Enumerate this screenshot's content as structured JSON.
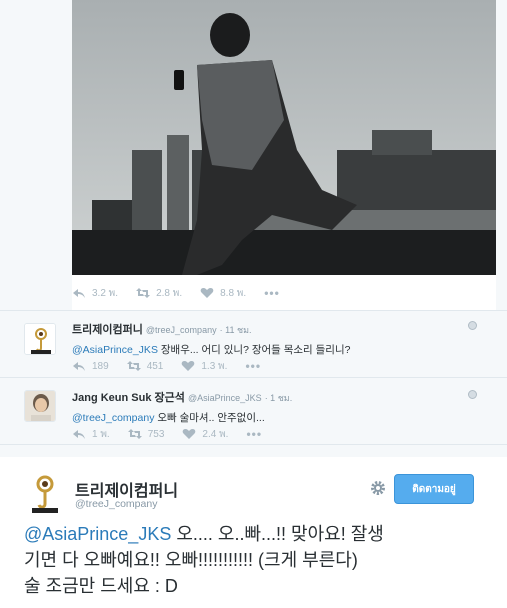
{
  "photo_tweet": {
    "stats": {
      "replies": "3.2 พ.",
      "retweets": "2.8 พ.",
      "likes": "8.8 พ."
    },
    "more_label": "•••"
  },
  "reply1": {
    "name": "트리제이컴퍼니",
    "handle": "@treeJ_company",
    "time": "· 11 ชม.",
    "mention": "@AsiaPrince_JKS",
    "text": " 장배우... 어디 있니? 장어들 목소리 들리니?",
    "stats": {
      "replies": "189",
      "retweets": "451",
      "likes": "1.3 พ."
    },
    "more_label": "•••"
  },
  "reply2": {
    "name": "Jang Keun Suk 장근석",
    "handle": "@AsiaPrince_JKS",
    "time": "· 1 ชม.",
    "mention": "@treeJ_company",
    "text": " 오빠 술마셔.. 안주없이...",
    "stats": {
      "replies": "1 พ.",
      "retweets": "753",
      "likes": "2.4 พ."
    },
    "more_label": "•••"
  },
  "main_tweet": {
    "name": "트리제이컴퍼니",
    "handle": "@treeJ_company",
    "follow_label": "ติดตามอยู่",
    "mention": "@AsiaPrince_JKS",
    "text_line1": " 오.... 오..빠...!! 맞아요! 잘생",
    "text_line2": "기면 다 오빠예요!! 오빠!!!!!!!!!!! (크게 부른다)",
    "text_line3": "술 조금만 드세요 : D"
  },
  "colors": {
    "link": "#2b7bb9",
    "follow_button": "#55acee",
    "muted": "#8899a6"
  }
}
